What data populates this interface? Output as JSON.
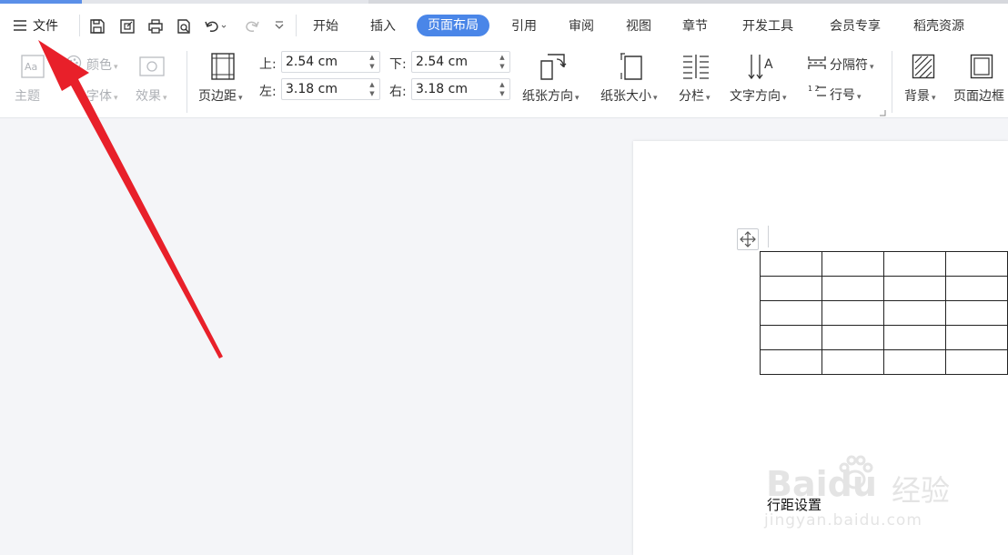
{
  "menu": {
    "file_label": "文件"
  },
  "tabs": [
    {
      "label": "开始"
    },
    {
      "label": "插入"
    },
    {
      "label": "页面布局"
    },
    {
      "label": "引用"
    },
    {
      "label": "审阅"
    },
    {
      "label": "视图"
    },
    {
      "label": "章节"
    },
    {
      "label": "开发工具"
    },
    {
      "label": "会员专享"
    },
    {
      "label": "稻壳资源"
    }
  ],
  "ribbon": {
    "theme": "主题",
    "color": "颜色",
    "font": "字体",
    "effect": "效果",
    "margins": "页边距",
    "top_label": "上:",
    "bottom_label": "下:",
    "left_label": "左:",
    "right_label": "右:",
    "top_value": "2.54 cm",
    "bottom_value": "2.54 cm",
    "left_value": "3.18 cm",
    "right_value": "3.18 cm",
    "orientation": "纸张方向",
    "size": "纸张大小",
    "columns": "分栏",
    "text_direction": "文字方向",
    "breaks": "分隔符",
    "line_numbers": "行号",
    "background": "背景",
    "page_border": "页面边框",
    "theme_icon_text": "Aa",
    "text_direction_icon_text": "A",
    "line_numbers_icon_text": "1 2"
  },
  "document": {
    "body_text": "行距设置"
  },
  "watermark": {
    "brand": "Baidu",
    "brand_cn": "经验",
    "url": "jingyan.baidu.com"
  },
  "colors": {
    "accent": "#4a86e8",
    "arrow": "#e8202a"
  }
}
